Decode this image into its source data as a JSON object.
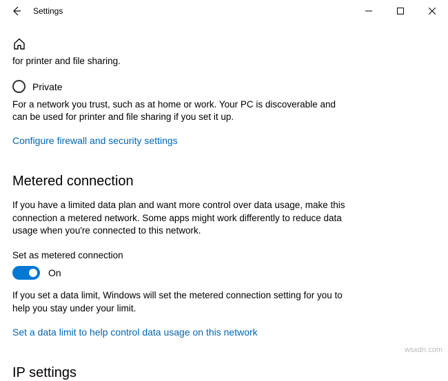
{
  "titlebar": {
    "title": "Settings"
  },
  "profile_truncated_text": "for printer and file sharing.",
  "private_option": {
    "label": "Private",
    "description": "For a network you trust, such as at home or work. Your PC is discoverable and can be used for printer and file sharing if you set it up."
  },
  "firewall_link": "Configure firewall and security settings",
  "metered": {
    "heading": "Metered connection",
    "description": "If you have a limited data plan and want more control over data usage, make this connection a metered network. Some apps might work differently to reduce data usage when you're connected to this network.",
    "toggle_label": "Set as metered connection",
    "toggle_state": "On",
    "note": "If you set a data limit, Windows will set the metered connection setting for you to help you stay under your limit.",
    "data_limit_link": "Set a data limit to help control data usage on this network"
  },
  "ip_settings_heading": "IP settings",
  "watermark": "wsxdn.com"
}
